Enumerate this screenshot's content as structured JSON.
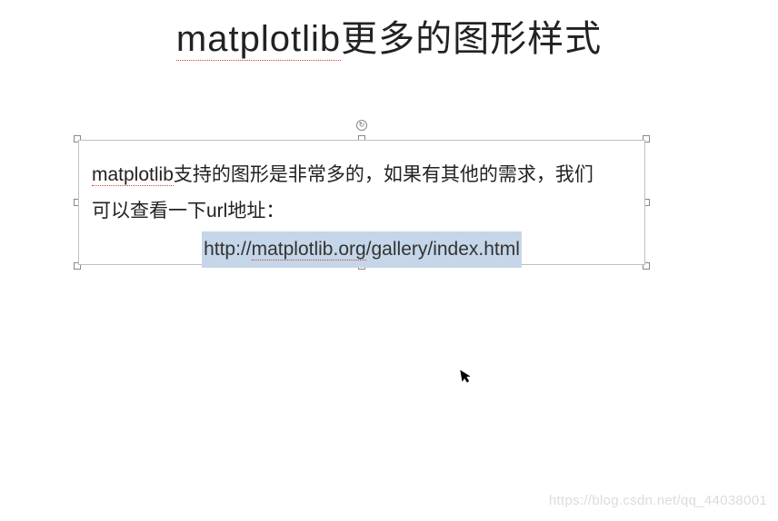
{
  "title": {
    "word1": "matplotlib",
    "rest": "更多的图形样式"
  },
  "textbox": {
    "line1_part1": "matplotlib",
    "line1_part2": "支持的图形是非常多的，如果有其他的需求，我们",
    "line2_part1": "可以查看一下",
    "line2_word": "url",
    "line2_part2": "地址：",
    "url_prefix": "http://",
    "url_domain": "matplotlib.org",
    "url_path": "/gallery/index.html"
  },
  "rotate_glyph": "↻",
  "cursor_glyph": "➤",
  "watermark": "https://blog.csdn.net/qq_44038001"
}
